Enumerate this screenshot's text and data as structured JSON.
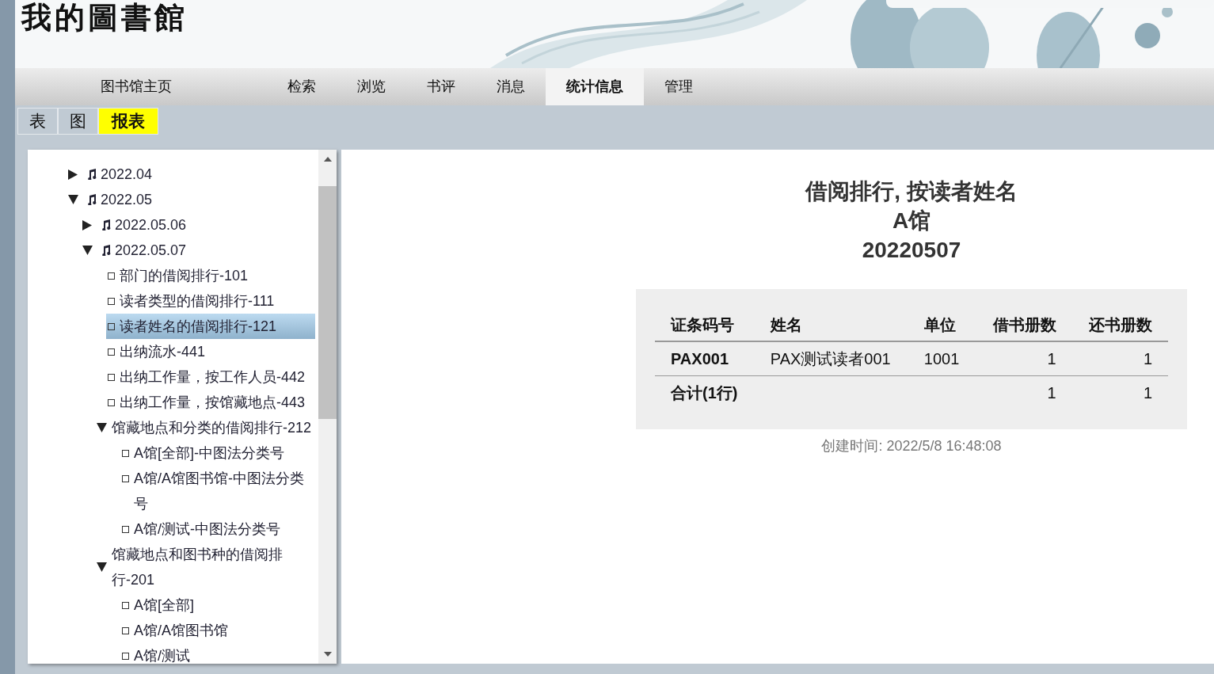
{
  "site_title": "我的圖書館",
  "nav": [
    {
      "label": "图书馆主页",
      "selected": false
    },
    {
      "label": "检索",
      "selected": false
    },
    {
      "label": "浏览",
      "selected": false
    },
    {
      "label": "书评",
      "selected": false
    },
    {
      "label": "消息",
      "selected": false
    },
    {
      "label": "统计信息",
      "selected": true
    },
    {
      "label": "管理",
      "selected": false
    }
  ],
  "subtabs": [
    {
      "label": "表",
      "selected": false
    },
    {
      "label": "图",
      "selected": false
    },
    {
      "label": "报表",
      "selected": true
    }
  ],
  "tree": [
    {
      "kind": "folder",
      "label": "2022.04",
      "expanded": false
    },
    {
      "kind": "folder",
      "label": "2022.05",
      "expanded": true,
      "children": [
        {
          "kind": "folder",
          "label": "2022.05.06",
          "expanded": false
        },
        {
          "kind": "folder",
          "label": "2022.05.07",
          "expanded": true,
          "children": [
            {
              "kind": "leaf",
              "label": "部门的借阅排行-101",
              "selected": false
            },
            {
              "kind": "leaf",
              "label": "读者类型的借阅排行-111",
              "selected": false
            },
            {
              "kind": "leaf",
              "label": "读者姓名的借阅排行-121",
              "selected": true
            },
            {
              "kind": "leaf",
              "label": "出纳流水-441",
              "selected": false
            },
            {
              "kind": "leaf",
              "label": "出纳工作量，按工作人员-442",
              "selected": false
            },
            {
              "kind": "leaf",
              "label": "出纳工作量，按馆藏地点-443",
              "selected": false
            },
            {
              "kind": "group",
              "label": "馆藏地点和分类的借阅排行-212",
              "expanded": true,
              "children": [
                {
                  "kind": "leaf",
                  "label": "A馆[全部]-中图法分类号",
                  "selected": false
                },
                {
                  "kind": "leaf",
                  "label": "A馆/A馆图书馆-中图法分类号",
                  "selected": false
                },
                {
                  "kind": "leaf",
                  "label": "A馆/测试-中图法分类号",
                  "selected": false
                }
              ]
            },
            {
              "kind": "group",
              "label": "馆藏地点和图书种的借阅排行-201",
              "expanded": true,
              "children": [
                {
                  "kind": "leaf",
                  "label": "A馆[全部]",
                  "selected": false
                },
                {
                  "kind": "leaf",
                  "label": "A馆/A馆图书馆",
                  "selected": false
                },
                {
                  "kind": "leaf",
                  "label": "A馆/测试",
                  "selected": false
                }
              ]
            }
          ]
        }
      ]
    }
  ],
  "report": {
    "title_lines": [
      "借阅排行, 按读者姓名",
      "A馆",
      "20220507"
    ],
    "columns": [
      "证条码号",
      "姓名",
      "单位",
      "借书册数",
      "还书册数"
    ],
    "rows": [
      [
        "PAX001",
        "PAX测试读者001",
        "1001",
        "1",
        "1"
      ]
    ],
    "total": {
      "label": "合计(1行)",
      "values": [
        "1",
        "1"
      ]
    },
    "created": "创建时间: 2022/5/8 16:48:08"
  }
}
